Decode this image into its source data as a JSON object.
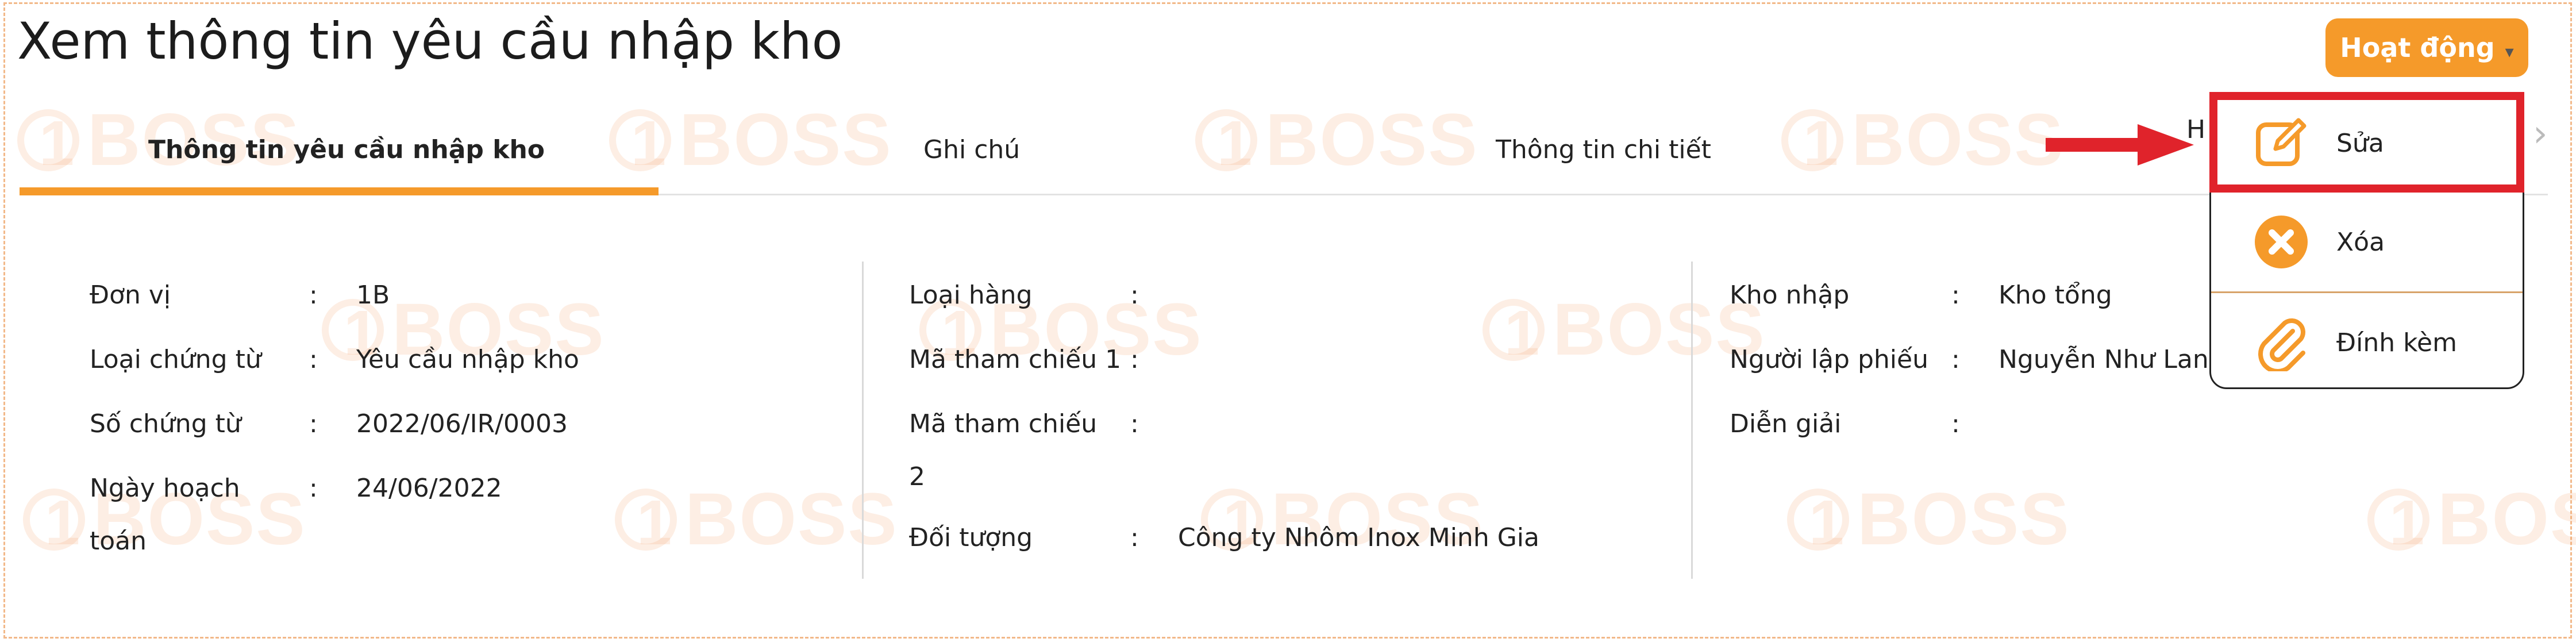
{
  "page": {
    "title": "Xem thông tin yêu cầu nhập kho",
    "action_button": {
      "label": "Hoạt động",
      "caret": "▾"
    },
    "watermark_text": "BOSS"
  },
  "tabs": [
    {
      "label": "Thông tin yêu cầu nhập kho",
      "active": true
    },
    {
      "label": "Ghi chú",
      "active": false
    },
    {
      "label": "Thông tin chi tiết",
      "active": false
    },
    {
      "label": "H",
      "active": false
    }
  ],
  "tab_scroll_icon": "›",
  "columns": {
    "left": [
      {
        "label": "Đơn vị",
        "value": "1B"
      },
      {
        "label": "Loại chứng từ",
        "value": "Yêu cầu nhập kho"
      },
      {
        "label": "Số chứng từ",
        "value": "2022/06/IR/0003"
      },
      {
        "label": "Ngày hoạch toán",
        "label_line1": "Ngày hoạch",
        "label_line2": "toán",
        "value": "24/06/2022"
      }
    ],
    "middle": [
      {
        "label": "Loại hàng",
        "value": ""
      },
      {
        "label": "Mã tham chiếu 1",
        "value": ""
      },
      {
        "label": "Mã tham chiếu 2",
        "label_line1": "Mã tham chiếu",
        "label_line2": "2",
        "value": ""
      },
      {
        "label": "Đối tượng",
        "value": "Công ty Nhôm Inox Minh Gia"
      }
    ],
    "right": [
      {
        "label": "Kho nhập",
        "value": "Kho tổng"
      },
      {
        "label": "Người lập phiếu",
        "value": "Nguyễn Như Lan"
      },
      {
        "label": "Diễn giải",
        "value": ""
      }
    ]
  },
  "colon": ":",
  "action_menu": {
    "items": [
      {
        "label": "Sửa",
        "icon": "edit-icon"
      },
      {
        "label": "Xóa",
        "icon": "delete-icon"
      },
      {
        "label": "Đính kèm",
        "icon": "paperclip-icon"
      }
    ]
  },
  "colors": {
    "accent": "#f59a2a",
    "highlight": "#e0232b",
    "arrow": "#e0232b"
  }
}
